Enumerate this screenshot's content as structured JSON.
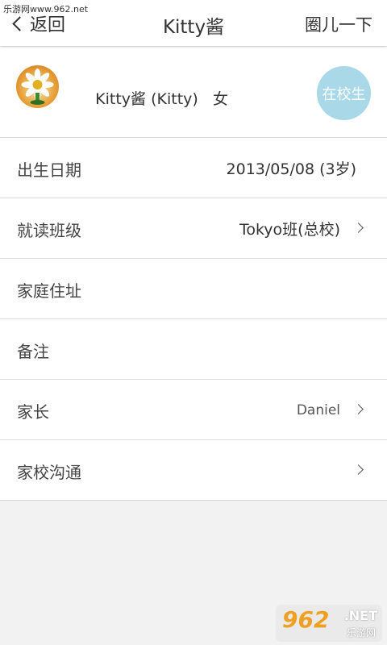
{
  "watermark_top": "乐游网www.962.net",
  "header": {
    "back_label": "返回",
    "title": "Kitty酱",
    "right_label": "圈儿一下"
  },
  "profile": {
    "name": "Kitty酱 (Kitty)",
    "gender": "女",
    "status": "在校生",
    "status_color": "#a9d8e8"
  },
  "rows": [
    {
      "label": "出生日期",
      "value": "2013/05/08 (3岁)"
    },
    {
      "label": "就读班级",
      "value": "Tokyo班(总校)"
    },
    {
      "label": "家庭住址",
      "value": ""
    },
    {
      "label": "备注",
      "value": ""
    },
    {
      "label": "家长",
      "value": "Daniel"
    },
    {
      "label": "家校沟通",
      "value": ""
    }
  ],
  "logo_watermark": {
    "main": "962",
    "suffix": ".NET",
    "sub": "乐游网"
  }
}
